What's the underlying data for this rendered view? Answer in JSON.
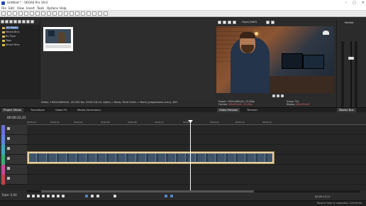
{
  "window": {
    "title": "Untitled * - VEGAS Pro 19.0"
  },
  "menu": [
    "File",
    "Edit",
    "View",
    "Insert",
    "Tools",
    "Options",
    "Help"
  ],
  "project_media": {
    "tree": [
      "All Media",
      "Media Bins",
      "By Type",
      "Tags",
      "Smart Bins"
    ],
    "media_info": "Video: 1920x1080x32, 25,000 fps, 00:00:18,10, Alpha = None, Field Order = None (progressive scan), AVC"
  },
  "tabs": [
    "Project Media",
    "Transitions",
    "Video FX",
    "Media Generators"
  ],
  "preview": {
    "quality": "Good (Half)",
    "info_labels": [
      "Project:",
      "Preview:",
      "Video Preview"
    ],
    "project": "1920x1080x32, 25,000p",
    "preview_value": "960x540x32, 25,000p",
    "frame_label": "Frame:",
    "frame": "321",
    "display_label": "Display:",
    "display": "461x259x32",
    "tabs": [
      "Video Preview",
      "Trimmer"
    ]
  },
  "master": {
    "label": "Master",
    "tab": "Master Bus"
  },
  "timeline": {
    "timecode": "00:00:12,21",
    "ruler": [
      "00:00:00",
      "00:00:02",
      "00:00:04",
      "00:00:06",
      "00:00:08",
      "00:00:10",
      "00:00:12",
      "00:00:14",
      "00:00:16",
      "00:00:18"
    ]
  },
  "transport": {
    "rate": "Rate: 0,00",
    "timecode_right": "00:00:12,21"
  },
  "status": {
    "text": "Record Time (2 channels): 115:09:44"
  }
}
